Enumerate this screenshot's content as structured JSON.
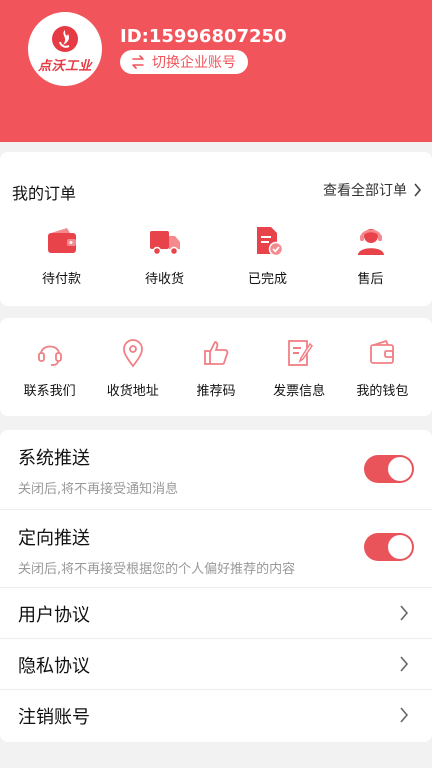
{
  "header": {
    "user_id": "ID:15996807250",
    "logo_text": "点沃工业",
    "switch_label": "切换企业账号",
    "switch_icon": "swap-icon"
  },
  "orders": {
    "title": "我的订单",
    "view_all": "查看全部订单",
    "items": [
      {
        "label": "待付款",
        "icon": "wallet-icon"
      },
      {
        "label": "待收货",
        "icon": "truck-icon"
      },
      {
        "label": "已完成",
        "icon": "document-check-icon"
      },
      {
        "label": "售后",
        "icon": "customer-service-icon"
      }
    ]
  },
  "tools": {
    "items": [
      {
        "label": "联系我们",
        "icon": "headset-icon"
      },
      {
        "label": "收货地址",
        "icon": "location-pin-icon"
      },
      {
        "label": "推荐码",
        "icon": "thumbs-up-icon"
      },
      {
        "label": "发票信息",
        "icon": "invoice-icon"
      },
      {
        "label": "我的钱包",
        "icon": "wallet-outline-icon"
      }
    ]
  },
  "settings": {
    "push": {
      "title": "系统推送",
      "desc": "关闭后,将不再接受通知消息",
      "enabled": true
    },
    "targeted": {
      "title": "定向推送",
      "desc": "关闭后,将不再接受根据您的个人偏好推荐的内容",
      "enabled": true
    },
    "links": [
      {
        "title": "用户协议"
      },
      {
        "title": "隐私协议"
      },
      {
        "title": "注销账号"
      }
    ]
  },
  "colors": {
    "brand": "#f2545b",
    "toggle_on": "#e9545a"
  }
}
